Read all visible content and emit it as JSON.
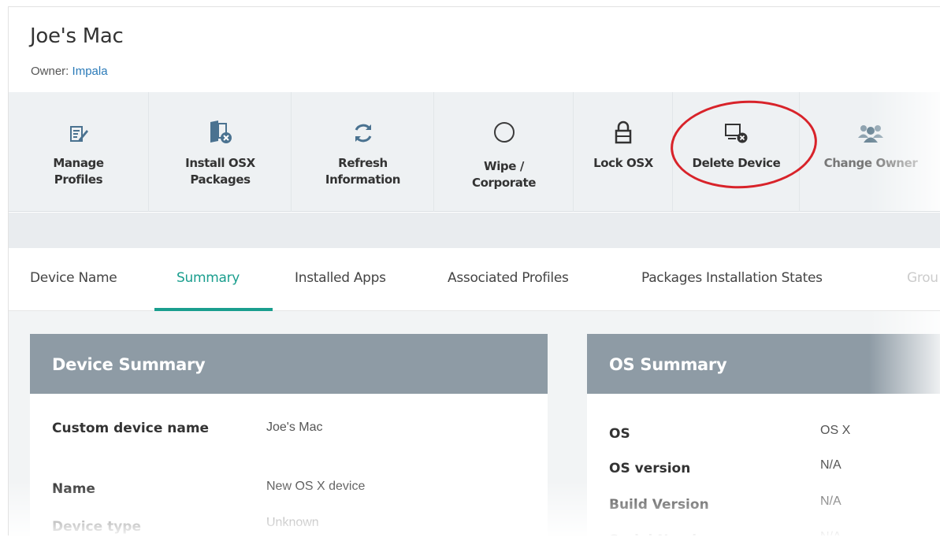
{
  "header": {
    "title": "Joe's Mac",
    "owner_label": "Owner:",
    "owner_name": "Impala"
  },
  "toolbar": {
    "items": [
      {
        "label_1": "Manage",
        "label_2": "Profiles",
        "icon": "manage-profiles-icon"
      },
      {
        "label_1": "Install OSX",
        "label_2": "Packages",
        "icon": "install-package-icon"
      },
      {
        "label_1": "Refresh",
        "label_2": "Information",
        "icon": "refresh-icon"
      },
      {
        "label_1": "Wipe /",
        "label_2": "Corporate",
        "icon": "wipe-icon"
      },
      {
        "label_1": "Lock OSX",
        "label_2": "",
        "icon": "lock-icon"
      },
      {
        "label_1": "Delete Device",
        "label_2": "",
        "icon": "delete-device-icon"
      },
      {
        "label_1": "Change Owner",
        "label_2": "",
        "icon": "users-icon"
      }
    ]
  },
  "tabs": [
    {
      "label": "Device Name"
    },
    {
      "label": "Summary",
      "active": true
    },
    {
      "label": "Installed Apps"
    },
    {
      "label": "Associated Profiles"
    },
    {
      "label": "Packages Installation States"
    },
    {
      "label": "Grou"
    }
  ],
  "device_summary": {
    "title": "Device Summary",
    "rows": [
      {
        "key": "Custom device name",
        "value": "Joe's Mac"
      },
      {
        "key": "Name",
        "value": "New OS X device"
      },
      {
        "key": "Device type",
        "value": "Unknown"
      }
    ]
  },
  "os_summary": {
    "title": "OS Summary",
    "rows": [
      {
        "key": "OS",
        "value": "OS X"
      },
      {
        "key": "OS version",
        "value": "N/A"
      },
      {
        "key": "Build Version",
        "value": "N/A"
      },
      {
        "key": "Serial Number",
        "value": "N/A"
      }
    ]
  },
  "colors": {
    "accent": "#1a9e8e",
    "card_header": "#8e9ba5",
    "link": "#2a7ab8",
    "highlight": "#d8232a",
    "icon": "#4a7290"
  }
}
